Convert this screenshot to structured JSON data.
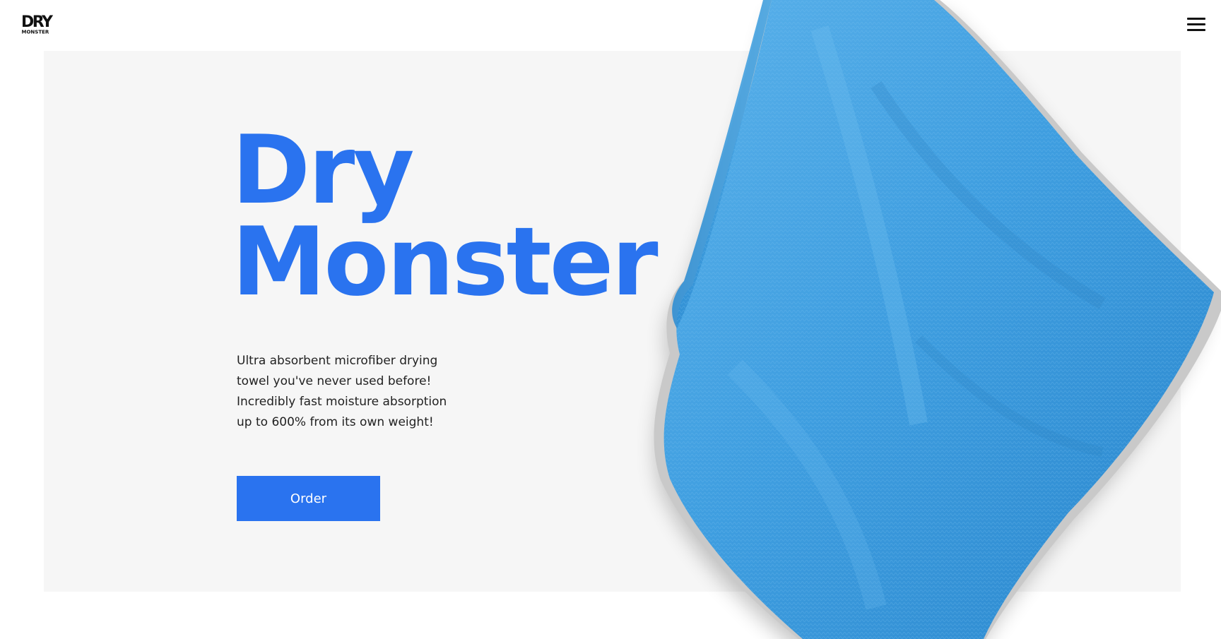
{
  "brand": {
    "logo_line1": "DRY",
    "logo_line2": "MONSTER"
  },
  "header": {
    "menu_icon": "hamburger-menu-icon"
  },
  "hero": {
    "title_line1": "Dry",
    "title_line2": "Monster",
    "description_lines": [
      "Ultra absorbent microfiber drying",
      "towel you've never used before!",
      "Incredibly fast moisture absorption",
      "up to 600% from its own weight!"
    ],
    "order_label": "Order"
  },
  "product_image": {
    "subject": "blue microfiber towel with grey trim"
  },
  "colors": {
    "accent": "#2a73ef",
    "panel": "#f6f6f6",
    "towel": "#3f9ee0",
    "towel_trim": "#c9c9c9"
  }
}
